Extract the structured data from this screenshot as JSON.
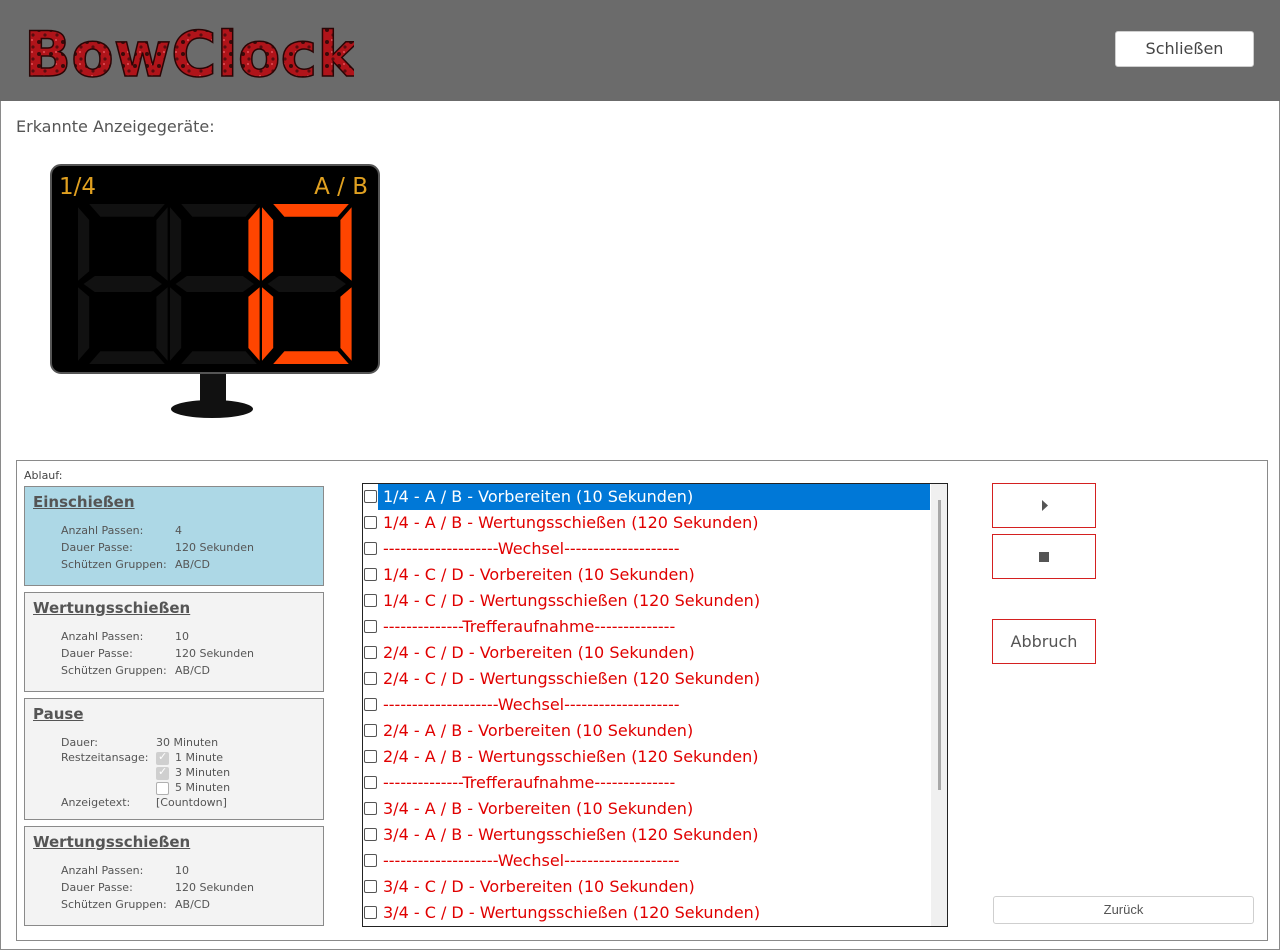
{
  "app": {
    "logo_text": "BowClock",
    "close_label": "Schließen",
    "devices_label": "Erkannte Anzeigegeräte:"
  },
  "display": {
    "end": "1/4",
    "groups": "A / B",
    "digits": [
      "",
      "",
      "10"
    ],
    "active_color": "#ff4500",
    "label_color": "#e0a020"
  },
  "sequence": {
    "label": "Ablauf:",
    "cards": [
      {
        "title": "Einschießen",
        "active": true,
        "fields": [
          {
            "label": "Anzahl Passen:",
            "value": "4"
          },
          {
            "label": "Dauer Passe:",
            "value": "120 Sekunden"
          },
          {
            "label": "Schützen Gruppen:",
            "value": "AB/CD"
          }
        ]
      },
      {
        "title": "Wertungsschießen",
        "active": false,
        "fields": [
          {
            "label": "Anzahl Passen:",
            "value": "10"
          },
          {
            "label": "Dauer Passe:",
            "value": "120 Sekunden"
          },
          {
            "label": "Schützen Gruppen:",
            "value": "AB/CD"
          }
        ]
      },
      {
        "title": "Pause",
        "active": false,
        "duration_label": "Dauer:",
        "duration_value": "30 Minuten",
        "remaining_label": "Restzeitansage:",
        "remaining_options": [
          {
            "label": "1 Minute",
            "checked": true
          },
          {
            "label": "3 Minuten",
            "checked": true
          },
          {
            "label": "5 Minuten",
            "checked": false
          }
        ],
        "display_text_label": "Anzeigetext:",
        "display_text_value": "[Countdown]"
      },
      {
        "title": "Wertungsschießen",
        "active": false,
        "fields": [
          {
            "label": "Anzahl Passen:",
            "value": "10"
          },
          {
            "label": "Dauer Passe:",
            "value": "120 Sekunden"
          },
          {
            "label": "Schützen Gruppen:",
            "value": "AB/CD"
          }
        ]
      }
    ]
  },
  "steps": [
    {
      "text": "1/4 - A / B -  Vorbereiten (10 Sekunden)",
      "selected": true
    },
    {
      "text": "1/4 - A / B -  Wertungsschießen (120 Sekunden)",
      "selected": false
    },
    {
      "text": "--------------------Wechsel--------------------",
      "selected": false
    },
    {
      "text": "1/4 - C / D -  Vorbereiten (10 Sekunden)",
      "selected": false
    },
    {
      "text": "1/4 - C / D -  Wertungsschießen (120 Sekunden)",
      "selected": false
    },
    {
      "text": "--------------Trefferaufnahme--------------",
      "selected": false
    },
    {
      "text": "2/4 - C / D -  Vorbereiten (10 Sekunden)",
      "selected": false
    },
    {
      "text": "2/4 - C / D -  Wertungsschießen (120 Sekunden)",
      "selected": false
    },
    {
      "text": "--------------------Wechsel--------------------",
      "selected": false
    },
    {
      "text": "2/4 - A / B -  Vorbereiten (10 Sekunden)",
      "selected": false
    },
    {
      "text": "2/4 - A / B -  Wertungsschießen (120 Sekunden)",
      "selected": false
    },
    {
      "text": "--------------Trefferaufnahme--------------",
      "selected": false
    },
    {
      "text": "3/4 - A / B -  Vorbereiten (10 Sekunden)",
      "selected": false
    },
    {
      "text": "3/4 - A / B -  Wertungsschießen (120 Sekunden)",
      "selected": false
    },
    {
      "text": "--------------------Wechsel--------------------",
      "selected": false
    },
    {
      "text": "3/4 - C / D -  Vorbereiten (10 Sekunden)",
      "selected": false
    },
    {
      "text": "3/4 - C / D -  Wertungsschießen (120 Sekunden)",
      "selected": false
    }
  ],
  "controls": {
    "play_icon": "play-icon",
    "stop_icon": "stop-icon",
    "abort_label": "Abbruch",
    "back_label": "Zurück",
    "accent": "#d42020"
  }
}
